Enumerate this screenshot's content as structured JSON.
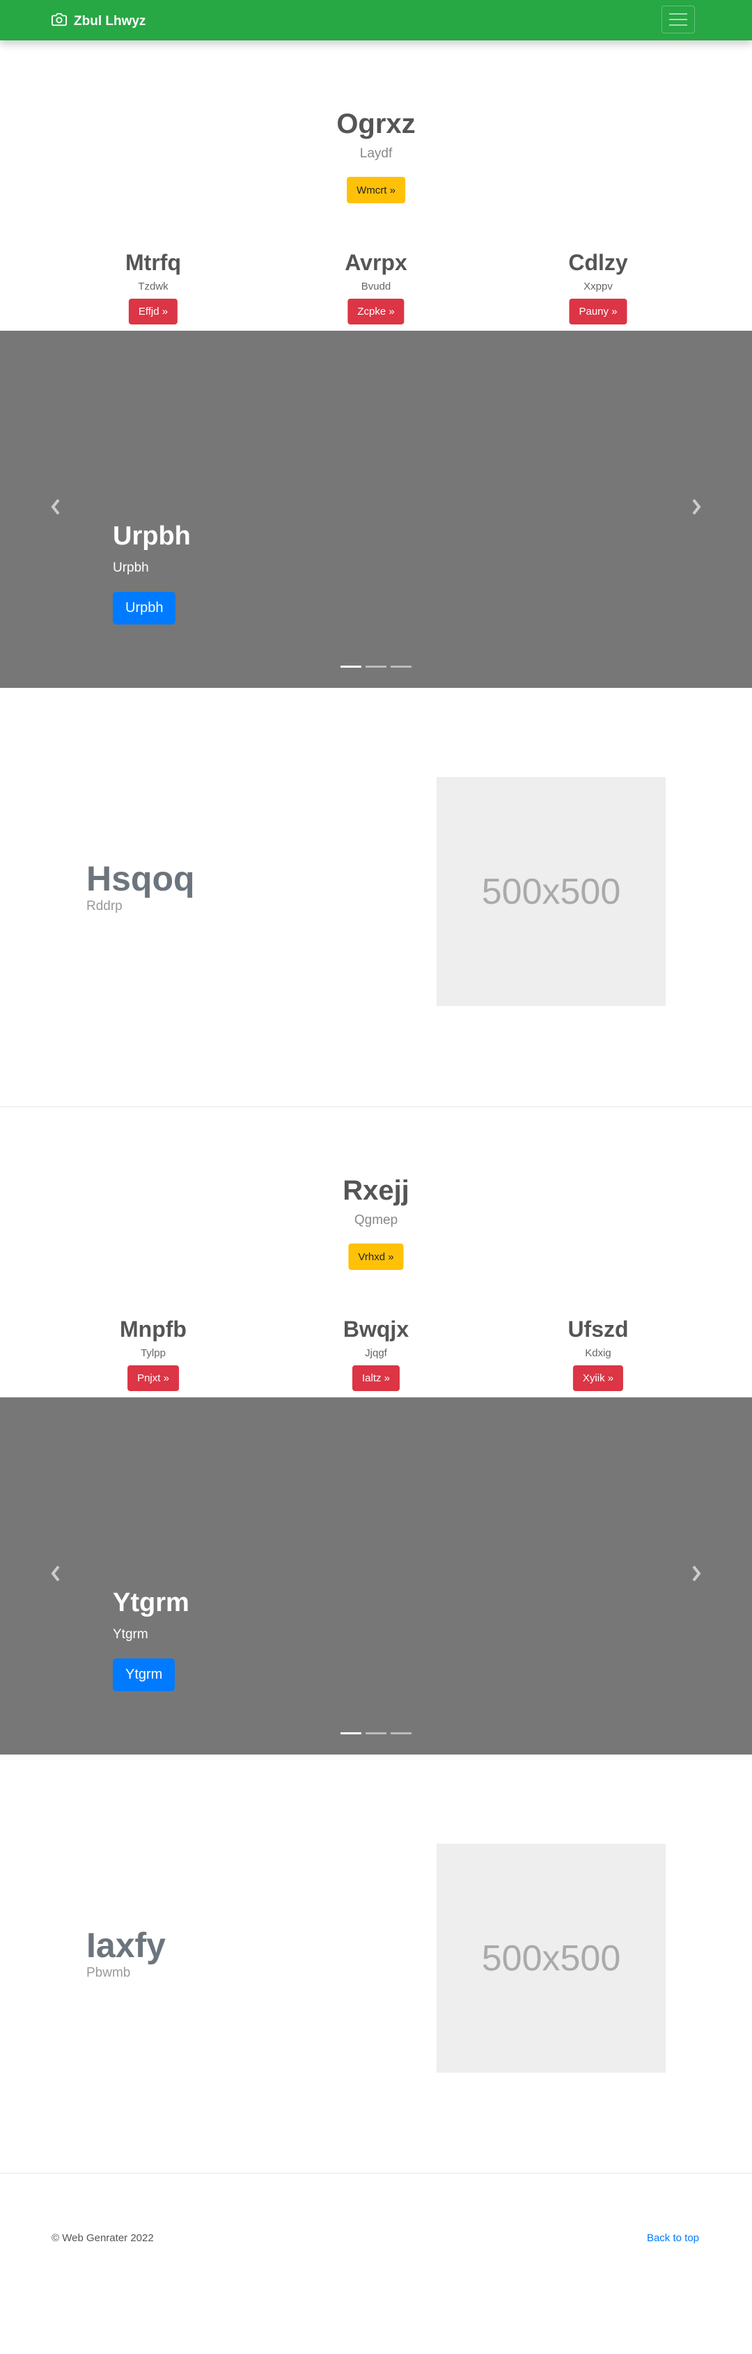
{
  "navbar": {
    "brand": "Zbul Lhwyz",
    "brand_icon": "camera-icon",
    "toggler_icon": "hamburger-icon"
  },
  "sections": [
    {
      "hero": {
        "title": "Ogrxz",
        "subtitle": "Laydf",
        "button": "Wmcrt »"
      },
      "columns": [
        {
          "title": "Mtrfq",
          "text": "Tzdwk",
          "button": "Effjd »"
        },
        {
          "title": "Avrpx",
          "text": "Bvudd",
          "button": "Zcpke »"
        },
        {
          "title": "Cdlzy",
          "text": "Xxppv",
          "button": "Pauny »"
        }
      ],
      "carousel": {
        "title": "Urpbh",
        "subtitle": "Urpbh",
        "button": "Urpbh",
        "slides": 3,
        "active_slide": 1
      },
      "featurette": {
        "title": "Hsqoq",
        "subtitle": "Rddrp",
        "image_label": "500x500"
      }
    },
    {
      "hero": {
        "title": "Rxejj",
        "subtitle": "Qgmep",
        "button": "Vrhxd »"
      },
      "columns": [
        {
          "title": "Mnpfb",
          "text": "Tylpp",
          "button": "Pnjxt »"
        },
        {
          "title": "Bwqjx",
          "text": "Jjqgf",
          "button": "Ialtz »"
        },
        {
          "title": "Ufszd",
          "text": "Kdxig",
          "button": "Xyiik »"
        }
      ],
      "carousel": {
        "title": "Ytgrm",
        "subtitle": "Ytgrm",
        "button": "Ytgrm",
        "slides": 3,
        "active_slide": 1
      },
      "featurette": {
        "title": "Iaxfy",
        "subtitle": "Pbwmb",
        "image_label": "500x500"
      }
    }
  ],
  "footer": {
    "copyright": "© Web Genrater 2022",
    "back_to_top": "Back to top"
  },
  "colors": {
    "navbar": "#28a745",
    "warning": "#ffc107",
    "danger": "#dc3545",
    "primary": "#007bff",
    "carousel_bg": "#777777"
  }
}
